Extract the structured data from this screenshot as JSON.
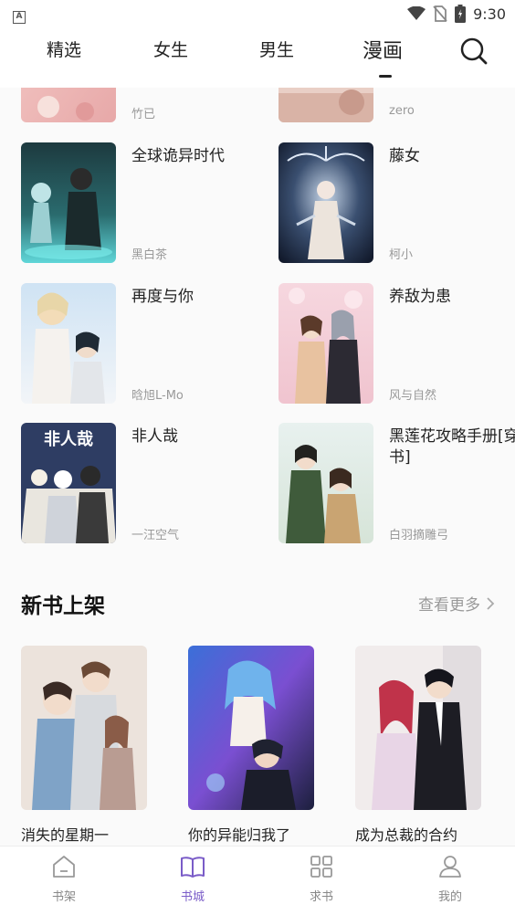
{
  "status_bar": {
    "time": "9:30",
    "app_icon": "A",
    "icons": [
      "wifi-icon",
      "no-sim-icon",
      "battery-icon"
    ]
  },
  "top_tabs": [
    {
      "label": "精选",
      "active": false
    },
    {
      "label": "女生",
      "active": false
    },
    {
      "label": "男生",
      "active": false
    },
    {
      "label": "漫画",
      "active": true
    }
  ],
  "partial_row": [
    {
      "author": "竹已"
    },
    {
      "author": "zero"
    }
  ],
  "books": [
    {
      "title": "全球诡异时代",
      "author": "黑白茶"
    },
    {
      "title": "藤女",
      "author": "柯小"
    },
    {
      "title": "再度与你",
      "author": "晗旭L-Mo"
    },
    {
      "title": "养敌为患",
      "author": "风与自然"
    },
    {
      "title": "非人哉",
      "author": "一汪空气",
      "cover_text": "非人哉"
    },
    {
      "title": "黑莲花攻略手册[穿书]",
      "author": "白羽摘雕弓"
    }
  ],
  "new_books_section": {
    "title": "新书上架",
    "see_more": "查看更多",
    "items": [
      {
        "title": "消失的星期一"
      },
      {
        "title": "你的异能归我了"
      },
      {
        "title": "成为总裁的合约"
      }
    ]
  },
  "bottom_nav": [
    {
      "label": "书架",
      "icon": "home-icon",
      "active": false
    },
    {
      "label": "书城",
      "icon": "book-icon",
      "active": true
    },
    {
      "label": "求书",
      "icon": "grid-icon",
      "active": false
    },
    {
      "label": "我的",
      "icon": "user-icon",
      "active": false
    }
  ],
  "colors": {
    "accent": "#7a5cc8",
    "text": "#222222",
    "muted": "#999999"
  }
}
